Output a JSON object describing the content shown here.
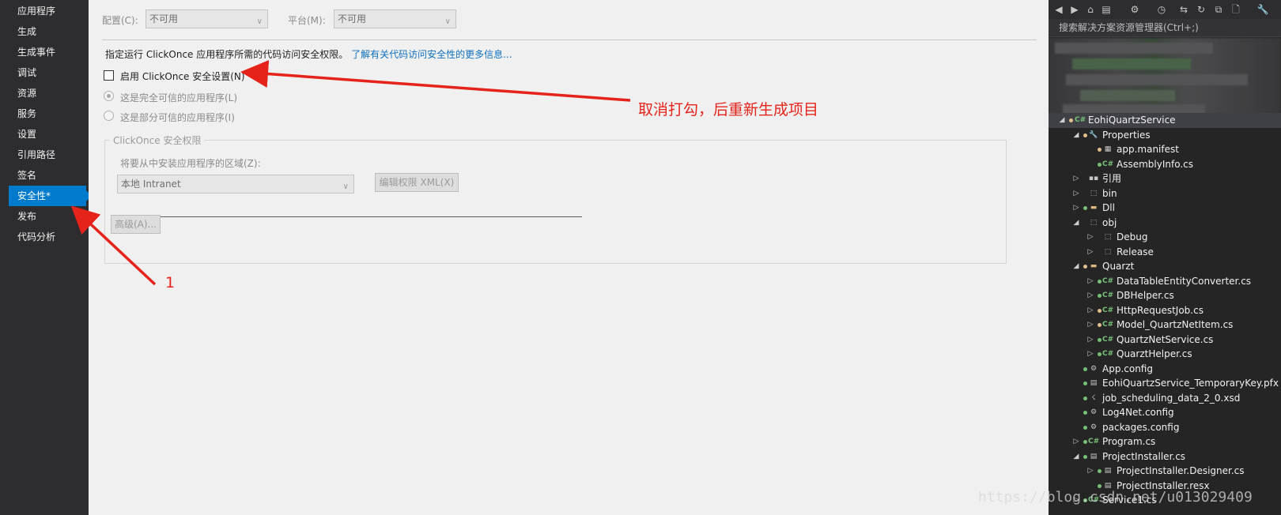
{
  "nav": {
    "items": [
      {
        "label": "应用程序",
        "active": false
      },
      {
        "label": "生成",
        "active": false
      },
      {
        "label": "生成事件",
        "active": false
      },
      {
        "label": "调试",
        "active": false
      },
      {
        "label": "资源",
        "active": false
      },
      {
        "label": "服务",
        "active": false
      },
      {
        "label": "设置",
        "active": false
      },
      {
        "label": "引用路径",
        "active": false
      },
      {
        "label": "签名",
        "active": false
      },
      {
        "label": "安全性*",
        "active": true
      },
      {
        "label": "发布",
        "active": false
      },
      {
        "label": "代码分析",
        "active": false
      }
    ]
  },
  "topbar": {
    "config_label": "配置(C):",
    "config_value": "不可用",
    "platform_label": "平台(M):",
    "platform_value": "不可用"
  },
  "security": {
    "description": "指定运行 ClickOnce 应用程序所需的代码访问安全权限。",
    "link": "了解有关代码访问安全性的更多信息...",
    "enable_checkbox_label": "启用 ClickOnce 安全设置(N)",
    "enable_checked": false,
    "full_trust_label": "这是完全可信的应用程序(L)",
    "partial_trust_label": "这是部分可信的应用程序(I)",
    "group_title": "ClickOnce 安全权限",
    "zone_label": "将要从中安装应用程序的区域(Z):",
    "zone_value": "本地 Intranet",
    "edit_xml_button": "编辑权限 XML(X)",
    "advanced_button": "高级(A)..."
  },
  "annotations": {
    "uncheck_note": "取消打勾，后重新生成项目",
    "step_number": "1",
    "color": "#e5231b"
  },
  "solution_explorer": {
    "search_placeholder": "搜索解决方案资源管理器(Ctrl+;)",
    "items": [
      {
        "label": "EohiQuartzService",
        "icon": "csharp-project-icon"
      },
      {
        "label": "Properties",
        "icon": "wrench-icon"
      },
      {
        "label": "app.manifest",
        "icon": "manifest-icon"
      },
      {
        "label": "AssemblyInfo.cs",
        "icon": "csharp-file-icon"
      },
      {
        "label": "引用",
        "icon": "references-icon"
      },
      {
        "label": "bin",
        "icon": "folder-dotted-icon"
      },
      {
        "label": "Dll",
        "icon": "folder-icon"
      },
      {
        "label": "obj",
        "icon": "folder-dotted-icon"
      },
      {
        "label": "Debug",
        "icon": "folder-dotted-icon"
      },
      {
        "label": "Release",
        "icon": "folder-dotted-icon"
      },
      {
        "label": "Quarzt",
        "icon": "folder-open-icon"
      },
      {
        "label": "DataTableEntityConverter.cs",
        "icon": "csharp-file-icon"
      },
      {
        "label": "DBHelper.cs",
        "icon": "csharp-file-icon"
      },
      {
        "label": "HttpRequestJob.cs",
        "icon": "csharp-file-icon"
      },
      {
        "label": "Model_QuartzNetItem.cs",
        "icon": "csharp-file-icon"
      },
      {
        "label": "QuartzNetService.cs",
        "icon": "csharp-file-icon"
      },
      {
        "label": "QuarztHelper.cs",
        "icon": "csharp-file-icon"
      },
      {
        "label": "App.config",
        "icon": "config-file-icon"
      },
      {
        "label": "EohiQuartzService_TemporaryKey.pfx",
        "icon": "certificate-icon"
      },
      {
        "label": "job_scheduling_data_2_0.xsd",
        "icon": "schema-file-icon"
      },
      {
        "label": "Log4Net.config",
        "icon": "config-file-icon"
      },
      {
        "label": "packages.config",
        "icon": "config-file-icon"
      },
      {
        "label": "Program.cs",
        "icon": "csharp-file-icon"
      },
      {
        "label": "ProjectInstaller.cs",
        "icon": "installer-file-icon"
      },
      {
        "label": "ProjectInstaller.Designer.cs",
        "icon": "designer-file-icon"
      },
      {
        "label": "ProjectInstaller.resx",
        "icon": "resx-file-icon"
      },
      {
        "label": "Service1.cs",
        "icon": "csharp-file-icon"
      }
    ]
  },
  "watermark": "https://blog.csdn.net/u013029409"
}
